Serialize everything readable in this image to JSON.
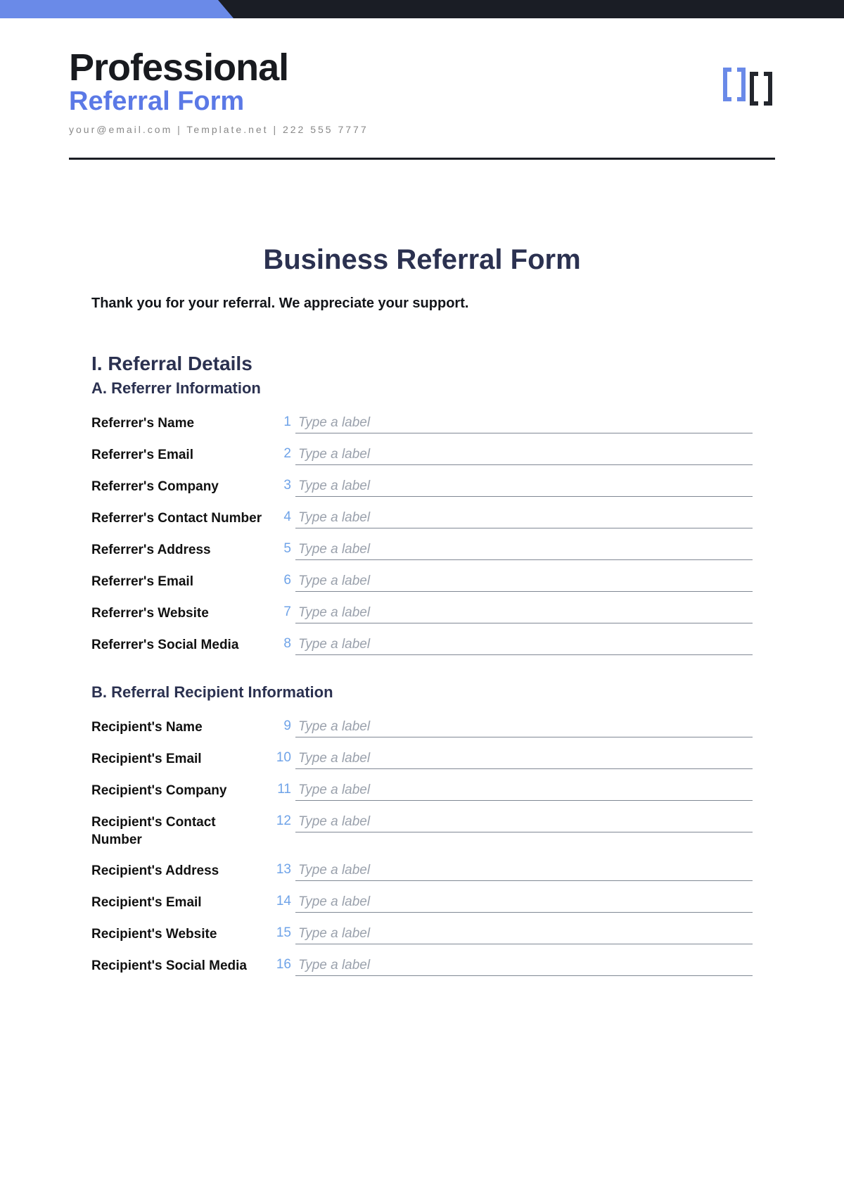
{
  "header": {
    "title": "Professional",
    "subtitle": "Referral Form",
    "contact": "your@email.com | Template.net | 222 555 7777"
  },
  "form": {
    "title": "Business Referral Form",
    "thank_you": "Thank you for your referral. We appreciate your support."
  },
  "section1": {
    "heading": "I. Referral Details",
    "subA": "A. Referrer Information",
    "subB": "B. Referral Recipient Information"
  },
  "placeholder": "Type a label",
  "fieldsA": [
    {
      "num": "1",
      "label": "Referrer's Name"
    },
    {
      "num": "2",
      "label": "Referrer's Email"
    },
    {
      "num": "3",
      "label": "Referrer's Company"
    },
    {
      "num": "4",
      "label": "Referrer's Contact Number"
    },
    {
      "num": "5",
      "label": "Referrer's Address"
    },
    {
      "num": "6",
      "label": "Referrer's Email"
    },
    {
      "num": "7",
      "label": "Referrer's Website"
    },
    {
      "num": "8",
      "label": "Referrer's Social Media"
    }
  ],
  "fieldsB": [
    {
      "num": "9",
      "label": "Recipient's Name"
    },
    {
      "num": "10",
      "label": "Recipient's Email"
    },
    {
      "num": "11",
      "label": "Recipient's Company"
    },
    {
      "num": "12",
      "label": "Recipient's Contact Number"
    },
    {
      "num": "13",
      "label": "Recipient's Address"
    },
    {
      "num": "14",
      "label": "Recipient's Email"
    },
    {
      "num": "15",
      "label": "Recipient's Website"
    },
    {
      "num": "16",
      "label": "Recipient's Social Media"
    }
  ]
}
